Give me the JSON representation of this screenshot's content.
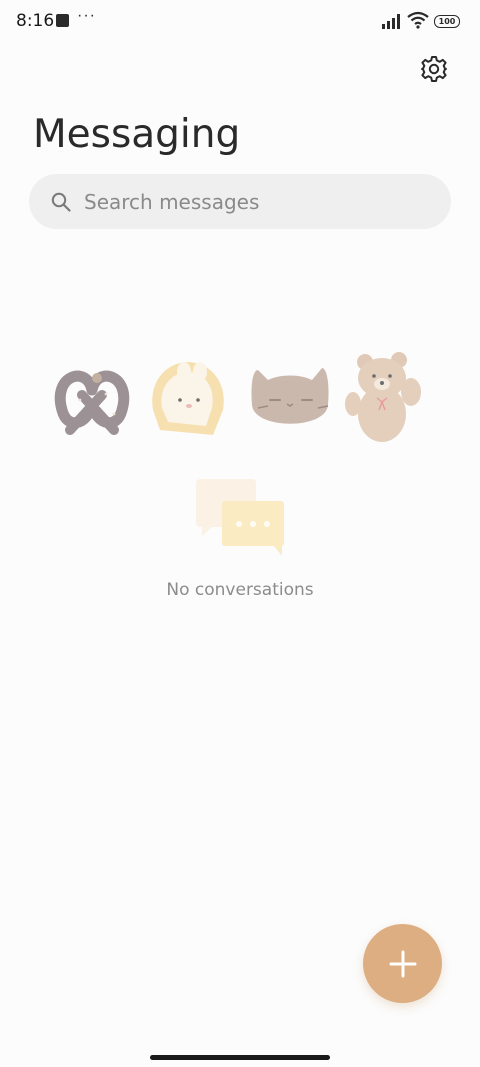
{
  "status_bar": {
    "time": "8:16",
    "more": "···",
    "battery": "100"
  },
  "header": {
    "title": "Messaging",
    "settings_icon": "gear-icon"
  },
  "search": {
    "placeholder": "Search messages",
    "icon": "search-icon"
  },
  "empty_state": {
    "illustrations": [
      "pretzel",
      "bunny-toast",
      "cat-bread",
      "teddy-bear"
    ],
    "icon": "chat-bubbles-icon",
    "message": "No conversations"
  },
  "fab": {
    "icon": "plus-icon",
    "color": "#dcae82"
  },
  "colors": {
    "background": "#fcfcfc",
    "search_bg": "#efefef",
    "accent": "#dcae82"
  }
}
